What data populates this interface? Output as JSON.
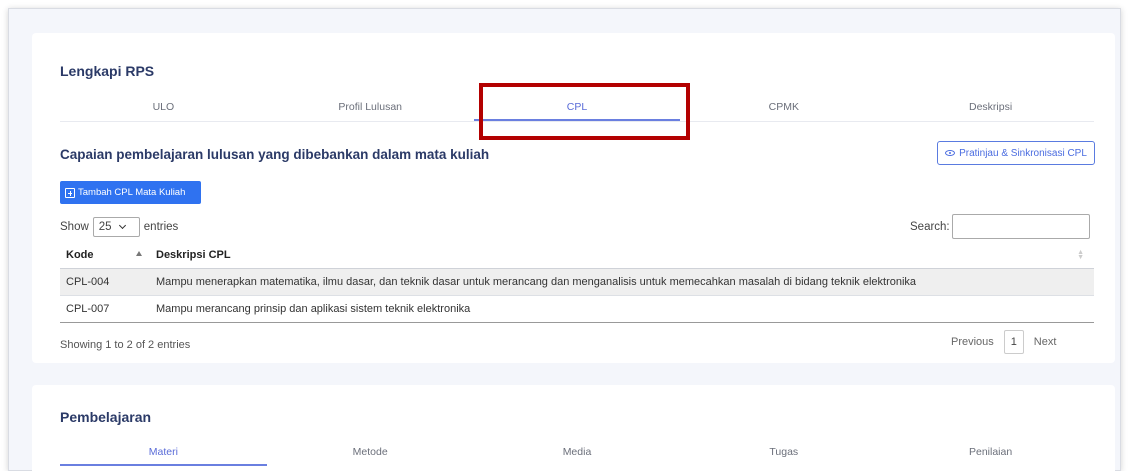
{
  "rps_card": {
    "title": "Lengkapi RPS",
    "tabs": [
      "ULO",
      "Profil Lulusan",
      "CPL",
      "CPMK",
      "Deskripsi"
    ],
    "active_tab": "CPL"
  },
  "cpl_section": {
    "title": "Capaian pembelajaran lulusan yang dibebankan dalam mata kuliah",
    "preview_button": "Pratinjau & Sinkronisasi CPL",
    "add_button": "Tambah CPL Mata Kuliah"
  },
  "datatable": {
    "show_label": "Show",
    "entries_value": "25",
    "entries_label": "entries",
    "search_label": "Search:",
    "columns": [
      "Kode",
      "Deskripsi CPL"
    ],
    "rows": [
      {
        "kode": "CPL-004",
        "deskripsi": "Mampu menerapkan matematika, ilmu dasar, dan teknik dasar untuk merancang dan menganalisis untuk memecahkan masalah di bidang teknik elektronika"
      },
      {
        "kode": "CPL-007",
        "deskripsi": "Mampu merancang prinsip dan aplikasi sistem teknik elektronika"
      }
    ],
    "info": "Showing 1 to 2 of 2 entries",
    "previous": "Previous",
    "page": "1",
    "next": "Next"
  },
  "pembelajaran_card": {
    "title": "Pembelajaran",
    "tabs": [
      "Materi",
      "Metode",
      "Media",
      "Tugas",
      "Penilaian"
    ],
    "active_tab": "Materi"
  },
  "colors": {
    "primary": "#2f72f0",
    "accent": "#6a7fe0",
    "highlight": "#b30000",
    "title": "#2b3a67"
  }
}
